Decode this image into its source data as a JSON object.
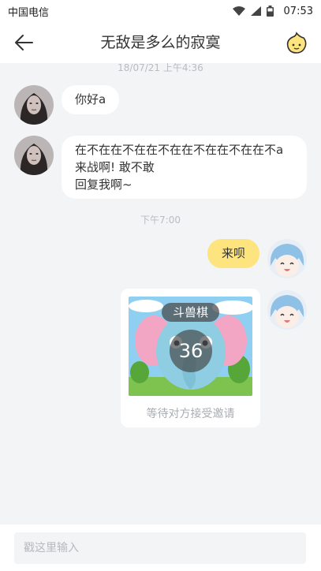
{
  "status_bar": {
    "carrier": "中国电信",
    "time": "07:53"
  },
  "header": {
    "title": "无敌是多么的寂寞"
  },
  "timestamps": {
    "first": "18/07/21 上午4:36",
    "second": "下午7:00"
  },
  "messages": {
    "greeting": "你好a",
    "long": {
      "line1": "在不在在不在在不在在不在在不在在不a",
      "line2": "来战啊! 敢不敢",
      "line3": "回复我啊~"
    },
    "reply": "来呗"
  },
  "game_invite": {
    "name": "斗兽棋",
    "countdown": "36",
    "status": "等待对方接受邀请"
  },
  "input": {
    "placeholder": "戳这里输入"
  },
  "colors": {
    "accent_bubble": "#fde47f",
    "background": "#f3f4f6"
  }
}
